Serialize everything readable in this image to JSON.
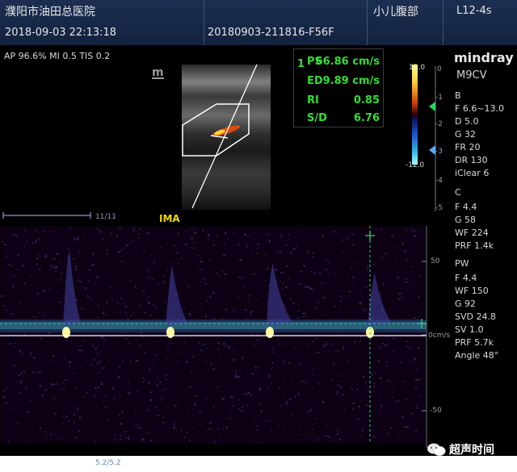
{
  "header": {
    "hospital": "濮阳市油田总医院",
    "exam": "小儿腹部",
    "probe": "L12-4s",
    "datetime": "2018-09-03 22:13:18",
    "patient_id": "20180903-211816-F56F"
  },
  "acoustic": "AP 96.6%  MI 0.5  TIS 0.2",
  "measurements": {
    "index": "1",
    "rows": [
      {
        "label": "PS",
        "value": "66.86 cm/s"
      },
      {
        "label": "ED",
        "value": "9.89 cm/s"
      },
      {
        "label": "RI",
        "value": "0.85"
      },
      {
        "label": "S/D",
        "value": "6.76"
      }
    ]
  },
  "brand": {
    "name": "mindray",
    "model": "M9CV"
  },
  "color_scale": {
    "top": "12.0",
    "bottom": "-12.0",
    "ticks": [
      "0",
      "-1",
      "-2",
      "-3",
      "-4",
      "-5"
    ]
  },
  "params": {
    "b": {
      "title": "B",
      "lines": [
        "F 6.6~13.0",
        "D 5.0",
        "G 32",
        "FR 20",
        "DR 130",
        "iClear 6"
      ]
    },
    "c": {
      "title": "C",
      "lines": [
        "F 4.4",
        "G 58",
        "WF 224",
        "PRF 1.4k"
      ]
    },
    "pw": {
      "title": "PW",
      "lines": [
        "F 4.4",
        "WF 150",
        "G 92",
        "SVD 24.8",
        "SV 1.0",
        "PRF 5.7k",
        "Angle 48°"
      ]
    }
  },
  "vessel": "IMA",
  "frame_counter": "11/11",
  "sweep_counter": "5.2/5.2",
  "spectrum_scale": {
    "top": "50",
    "baseline": "0cm/s",
    "bottom": "-50"
  },
  "watermark": "超声时间",
  "colors": {
    "header": "#1c2f52",
    "measure": "#33dd33",
    "vessel": "#f2d800",
    "accent": "#2bd65a"
  }
}
